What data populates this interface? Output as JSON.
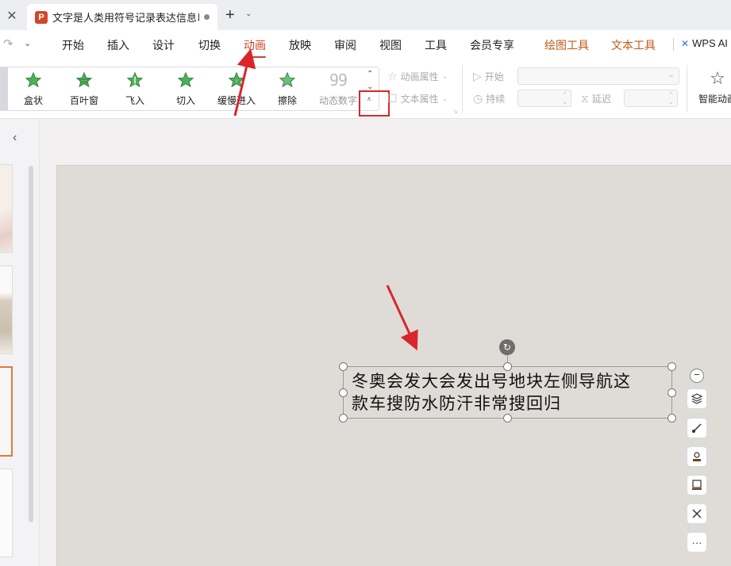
{
  "tabbar": {
    "close_glyph": "✕",
    "doc_title": "文字是人类用符号记录表达信息以(",
    "app_letter": "P",
    "new_tab_glyph": "+",
    "dropdown_glyph": "⌄"
  },
  "menubar": {
    "undo_glyph": "↷",
    "qa_glyph": "⌄",
    "items": [
      "开始",
      "插入",
      "设计",
      "切换",
      "动画",
      "放映",
      "审阅",
      "视图",
      "工具",
      "会员专享"
    ],
    "active": "动画",
    "context_tabs": [
      "绘图工具",
      "文本工具"
    ],
    "wps_ai_label": "WPS AI",
    "wps_ai_logo": "✕"
  },
  "ribbon": {
    "animations": [
      "盒状",
      "百叶窗",
      "飞入",
      "切入",
      "缓慢进入",
      "擦除",
      "动态数字"
    ],
    "number_icon_text": "99",
    "scroll_up": "⌃",
    "scroll_down": "⌄",
    "expand_glyph": "⩡",
    "anim_props_label": "动画属性",
    "text_props_label": "文本属性",
    "start_label": "开始",
    "duration_label": "持续",
    "delay_label": "延迟",
    "smart_anim_label": "智能动画",
    "corner_glyph": "↘"
  },
  "thumbs": {
    "collapse_glyph": "‹"
  },
  "slide": {
    "text_line1": "冬奥会发大会发出号地块左侧导航这",
    "text_line2": "款车搜防水防汗非常搜回归",
    "rotate_glyph": "↻"
  },
  "float_tools": {
    "minus": "−",
    "more": "···",
    "icons": [
      "layers-icon",
      "brush-icon",
      "stamp-icon",
      "frame-icon",
      "tools-icon",
      "more-icon"
    ]
  },
  "colors": {
    "accent": "#c8462a",
    "context_tab": "#c25a14",
    "annotation_red": "#d9262a",
    "star_green": "#3aa74a"
  }
}
